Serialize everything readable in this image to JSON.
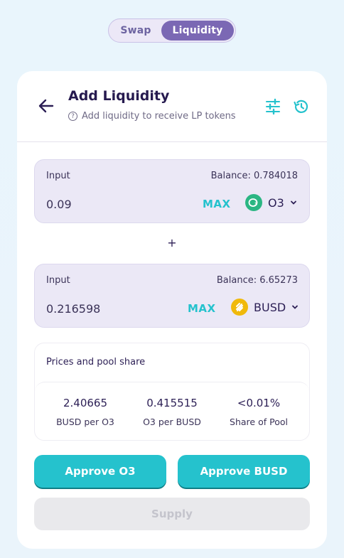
{
  "tabs": [
    {
      "label": "Swap",
      "active": false
    },
    {
      "label": "Liquidity",
      "active": true
    }
  ],
  "header": {
    "title": "Add Liquidity",
    "subtitle": "Add liquidity to receive LP tokens",
    "help_icon": "?"
  },
  "input_a": {
    "label": "Input",
    "balance": "Balance: 0.784018",
    "value": "0.09",
    "max_label": "MAX",
    "token": "O3",
    "token_icon": "o3-logo-icon",
    "token_color": "#2bb683"
  },
  "plus": "+",
  "input_b": {
    "label": "Input",
    "balance": "Balance: 6.65273",
    "value": "0.216598",
    "max_label": "MAX",
    "token": "BUSD",
    "token_icon": "busd-logo-icon",
    "token_color": "#f0b90b"
  },
  "prices": {
    "title": "Prices and pool share",
    "stats": [
      {
        "value": "2.40665",
        "label": "BUSD per O3"
      },
      {
        "value": "0.415515",
        "label": "O3 per BUSD"
      },
      {
        "value": "<0.01%",
        "label": "Share of Pool"
      }
    ]
  },
  "buttons": {
    "approve_a": "Approve O3",
    "approve_b": "Approve BUSD",
    "supply": "Supply"
  },
  "colors": {
    "accent": "#25c2cd",
    "purple": "#7b68b4"
  }
}
